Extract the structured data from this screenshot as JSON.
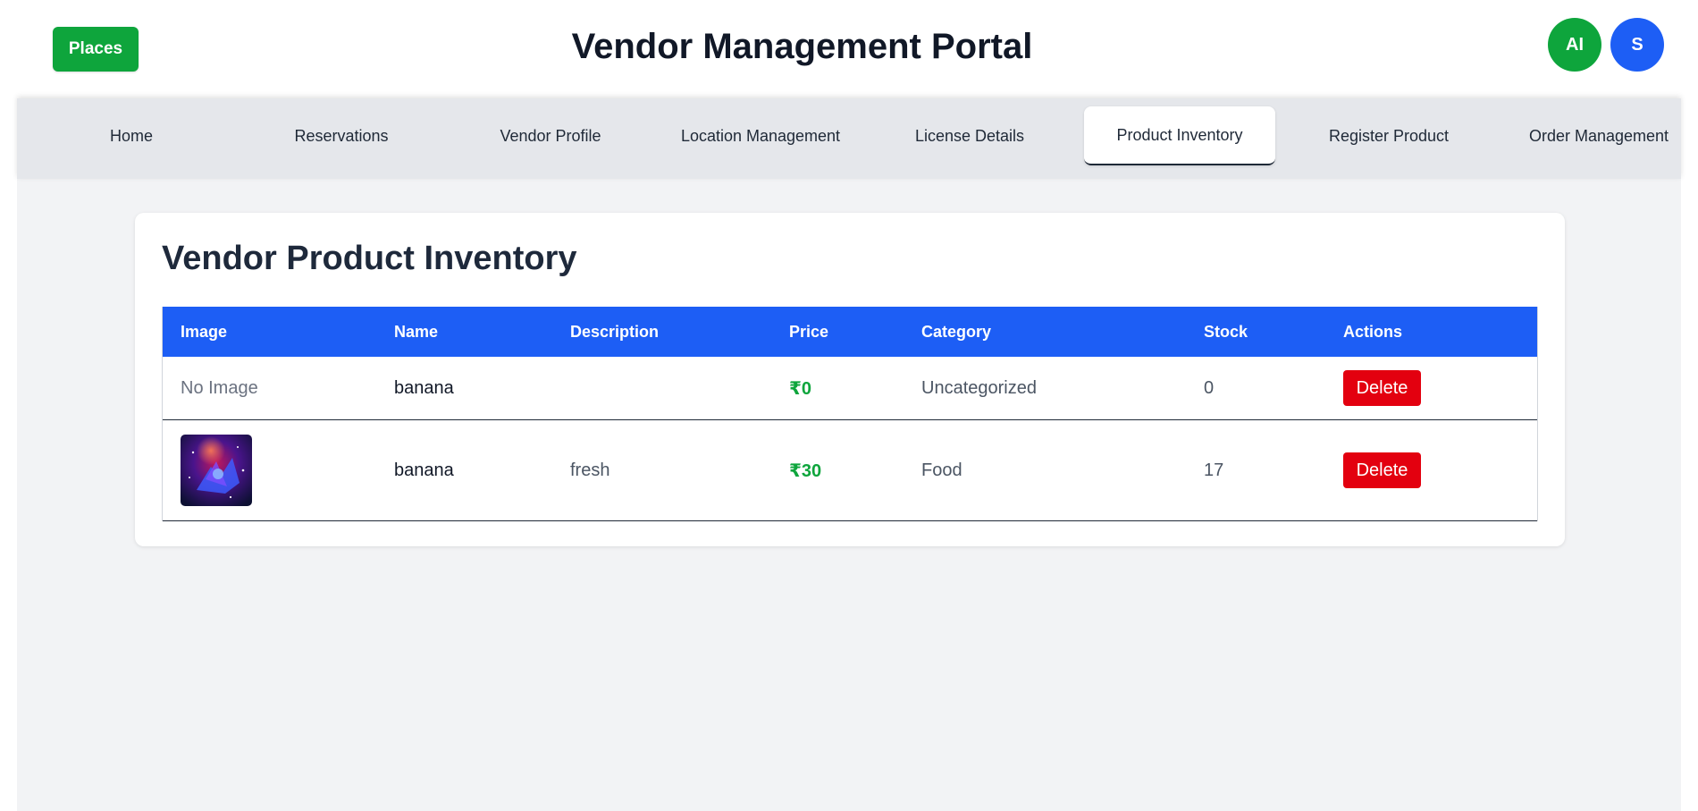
{
  "header": {
    "places_label": "Places",
    "title": "Vendor Management Portal",
    "avatars": [
      {
        "initials": "AI",
        "color": "#0ea53c"
      },
      {
        "initials": "S",
        "color": "#1d5ef5"
      }
    ]
  },
  "tabs": [
    {
      "label": "Home",
      "active": false
    },
    {
      "label": "Reservations",
      "active": false
    },
    {
      "label": "Vendor Profile",
      "active": false
    },
    {
      "label": "Location Management",
      "active": false
    },
    {
      "label": "License Details",
      "active": false
    },
    {
      "label": "Product Inventory",
      "active": true
    },
    {
      "label": "Register Product",
      "active": false
    },
    {
      "label": "Order Management",
      "active": false
    }
  ],
  "inventory": {
    "title": "Vendor Product Inventory",
    "columns": [
      "Image",
      "Name",
      "Description",
      "Price",
      "Category",
      "Stock",
      "Actions"
    ],
    "rows": [
      {
        "image_text": "No Image",
        "name": "banana",
        "description": "",
        "price": "₹0",
        "category": "Uncategorized",
        "stock": "0",
        "action": "Delete"
      },
      {
        "image_icon": "product-thumbnail",
        "name": "banana",
        "description": "fresh",
        "price": "₹30",
        "category": "Food",
        "stock": "17",
        "action": "Delete"
      }
    ]
  },
  "colors": {
    "brand_green": "#0ea53c",
    "brand_blue": "#1d5ef5",
    "danger_red": "#e3000f"
  }
}
